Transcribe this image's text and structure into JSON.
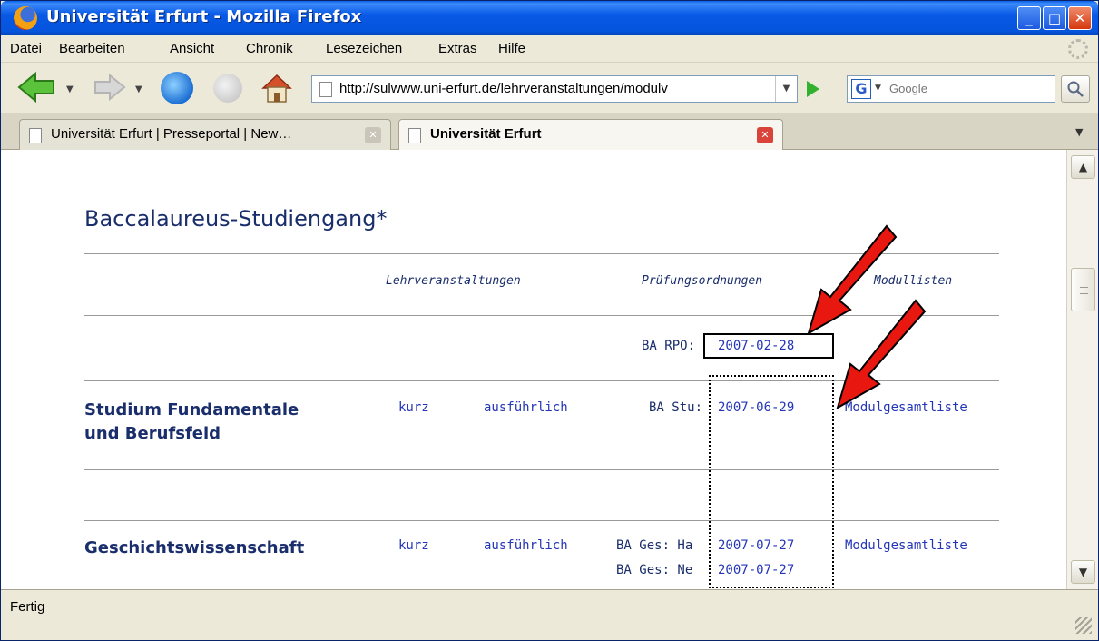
{
  "window": {
    "title": "Universität Erfurt - Mozilla Firefox"
  },
  "menu": {
    "items": [
      "Datei",
      "Bearbeiten",
      "Ansicht",
      "Chronik",
      "Lesezeichen",
      "Extras",
      "Hilfe"
    ]
  },
  "toolbar": {
    "url": "http://sulwww.uni-erfurt.de/lehrveranstaltungen/modulv",
    "search_placeholder": "Google",
    "search_engine_letter": "G"
  },
  "tabs": [
    {
      "label": "Universität Erfurt | Presseportal | New…",
      "active": false
    },
    {
      "label": "Universität Erfurt",
      "active": true
    }
  ],
  "page": {
    "title": "Baccalaureus-Studiengang*",
    "headers": {
      "lehrveranstaltungen": "Lehrveranstaltungen",
      "pruefungsordnungen": "Prüfungsordnungen",
      "modullisten": "Modullisten"
    },
    "rpo": {
      "label": "BA RPO:",
      "date": "2007-02-28"
    },
    "rows": [
      {
        "name_line1": "Studium Fundamentale",
        "name_line2": "und Berufsfeld",
        "kurz": "kurz",
        "ausfuehrlich": "ausführlich",
        "orders": [
          {
            "label": "BA Stu:",
            "date": "2007-06-29"
          }
        ],
        "modulliste": "Modulgesamtliste"
      },
      {
        "name_line1": "Geschichtswissenschaft",
        "kurz": "kurz",
        "ausfuehrlich": "ausführlich",
        "orders": [
          {
            "label": "BA Ges: Ha",
            "date": "2007-07-27"
          },
          {
            "label": "BA Ges: Ne",
            "date": "2007-07-27"
          }
        ],
        "modulliste": "Modulgesamtliste"
      }
    ]
  },
  "status": {
    "text": "Fertig"
  },
  "colors": {
    "title_blue": "#1a2e6c",
    "link_blue": "#2436b8",
    "arrow_red": "#e8170f"
  }
}
